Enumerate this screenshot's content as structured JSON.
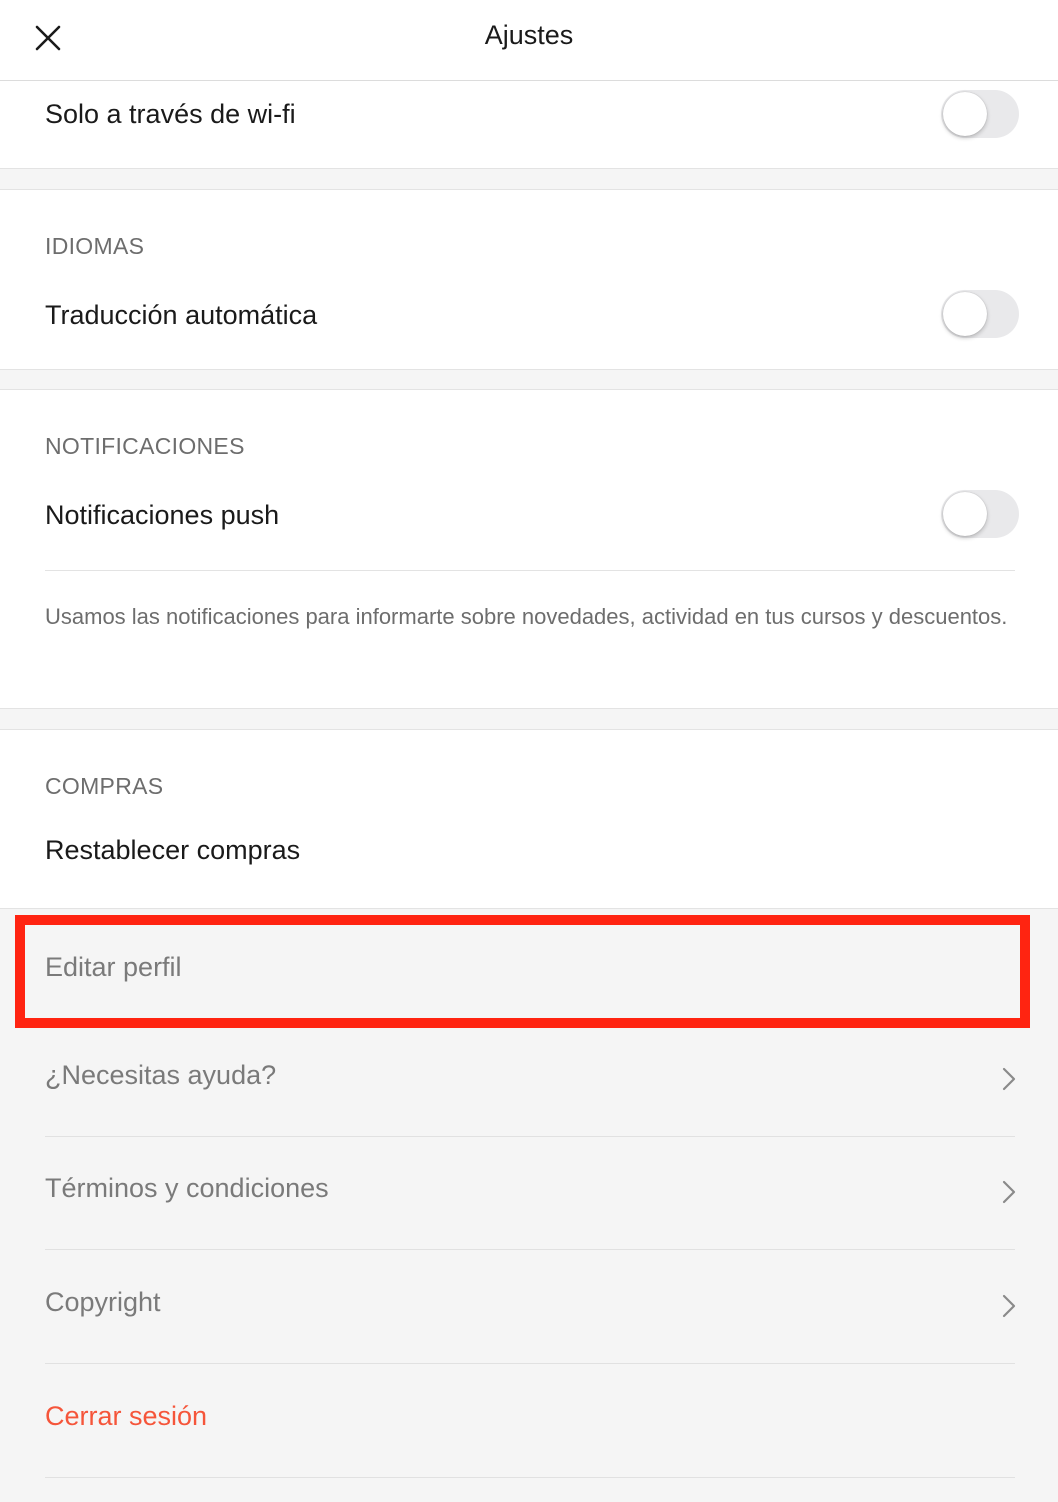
{
  "header": {
    "title": "Ajustes",
    "close_icon": "close-icon"
  },
  "wifi": {
    "label": "Solo a través de wi-fi",
    "toggle_on": false
  },
  "languages": {
    "title": "IDIOMAS",
    "auto_translate_label": "Traducción automática",
    "toggle_on": false
  },
  "notifications": {
    "title": "NOTIFICACIONES",
    "push_label": "Notificaciones push",
    "toggle_on": false,
    "description": "Usamos las notificaciones para informarte sobre novedades, actividad en tus cursos y descuentos."
  },
  "purchases": {
    "title": "COMPRAS",
    "restore_label": "Restablecer compras"
  },
  "menu": {
    "edit_profile": "Editar perfil",
    "help": "¿Necesitas ayuda?",
    "terms": "Términos y condiciones",
    "copyright": "Copyright",
    "logout": "Cerrar sesión"
  },
  "colors": {
    "logout": "#f5553a",
    "highlight": "#ff2411",
    "toggle_off": "#e9e9eb"
  }
}
